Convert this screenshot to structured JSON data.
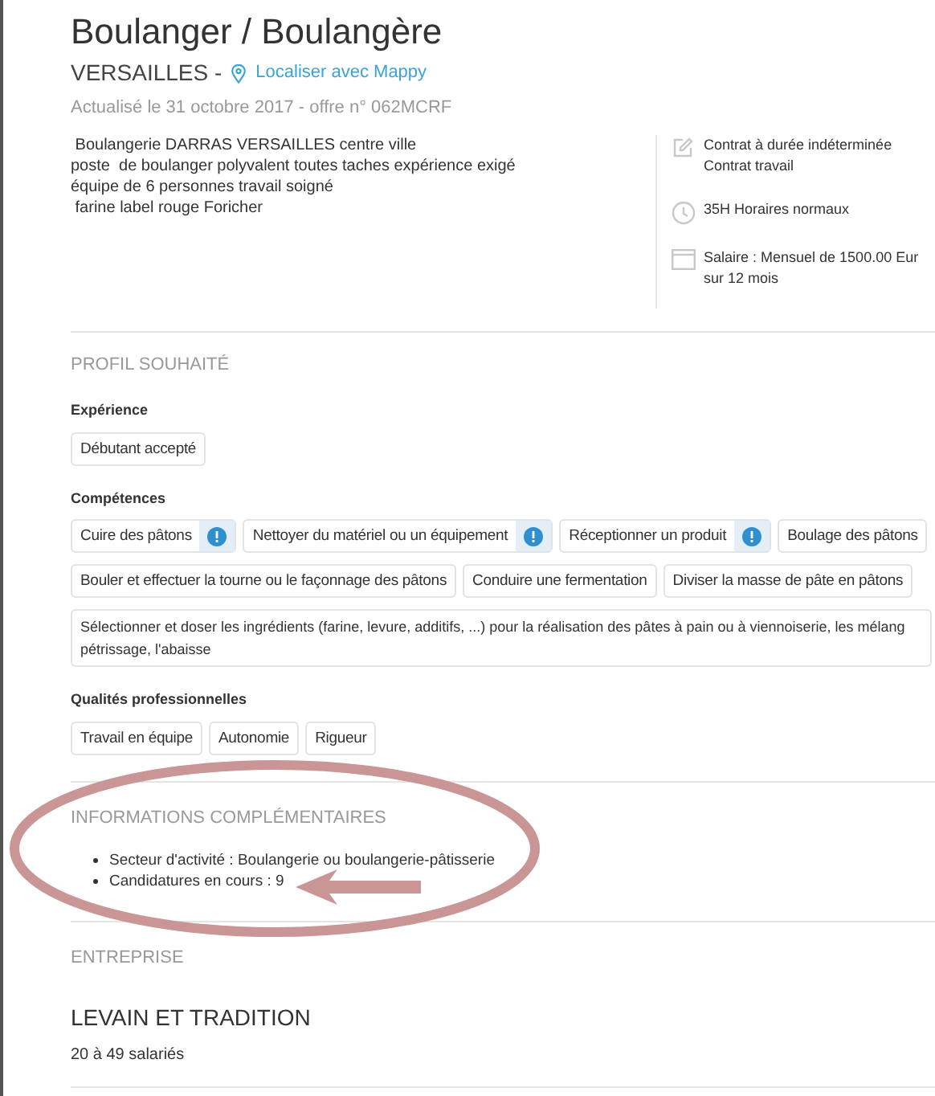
{
  "title": "Boulanger / Boulangère",
  "location": {
    "city": "VERSAILLES -",
    "map_link": "Localiser avec Mappy"
  },
  "updated": "Actualisé le 31 octobre 2017 - offre n° 062MCRF",
  "description": " Boulangerie DARRAS VERSAILLES centre ville\nposte  de boulanger polyvalent toutes taches expérience exigé\néquipe de 6 personnes travail soigné\n farine label rouge Foricher",
  "details": [
    {
      "kind": "contract",
      "text": "Contrat à durée indéterminée\nContrat travail"
    },
    {
      "kind": "hours",
      "text": "35H Horaires normaux"
    },
    {
      "kind": "salary",
      "text": "Salaire : Mensuel de 1500.00 Eur\nsur 12 mois"
    }
  ],
  "profile": {
    "heading": "PROFIL SOUHAITÉ",
    "groups": [
      {
        "label": "Expérience",
        "rows": [
          [
            {
              "text": "Débutant accepté",
              "info": false
            }
          ]
        ]
      },
      {
        "label": "Compétences",
        "rows": [
          [
            {
              "text": "Cuire des pâtons",
              "info": true
            },
            {
              "text": "Nettoyer du matériel ou un équipement",
              "info": true
            },
            {
              "text": "Réceptionner un produit",
              "info": true
            },
            {
              "text": "Boulage des pâtons",
              "info": false
            }
          ],
          [
            {
              "text": "Bouler et effectuer la tourne ou le façonnage des pâtons",
              "info": false
            },
            {
              "text": "Conduire une fermentation",
              "info": false
            },
            {
              "text": "Diviser la masse de pâte en pâtons",
              "info": false
            }
          ],
          [
            {
              "text": "Sélectionner et doser les ingrédients (farine, levure, additifs, ...) pour la réalisation des pâtes à pain ou à viennoiserie, les mélang\npétrissage, l'abaisse",
              "info": false
            }
          ]
        ]
      },
      {
        "label": "Qualités professionnelles",
        "rows": [
          [
            {
              "text": "Travail en équipe",
              "info": false
            },
            {
              "text": "Autonomie",
              "info": false
            },
            {
              "text": "Rigueur",
              "info": false
            }
          ]
        ]
      }
    ]
  },
  "additional": {
    "heading": "INFORMATIONS COMPLÉMENTAIRES",
    "items": [
      "Secteur d'activité : Boulangerie ou boulangerie-pâtisserie",
      "Candidatures en cours : 9"
    ]
  },
  "company": {
    "heading": "ENTREPRISE",
    "name": "LEVAIN ET TRADITION",
    "size": "20 à 49 salariés"
  }
}
